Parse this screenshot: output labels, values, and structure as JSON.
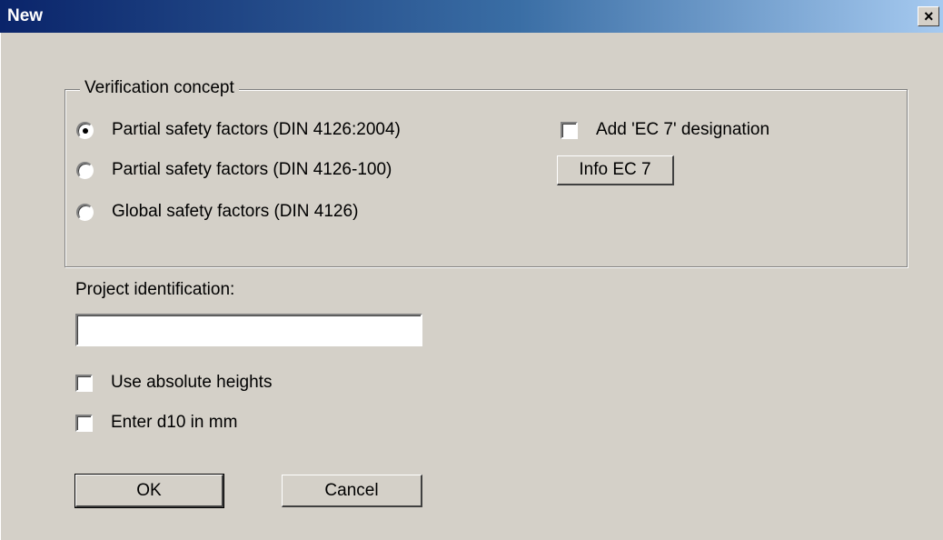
{
  "window": {
    "title": "New",
    "close_glyph": "×",
    "close_icon": "close-icon"
  },
  "verification": {
    "group_label": "Verification concept",
    "options": [
      {
        "label": "Partial safety factors (DIN 4126:2004)",
        "selected": true
      },
      {
        "label": "Partial safety factors (DIN 4126-100)",
        "selected": false
      },
      {
        "label": "Global safety factors (DIN 4126)",
        "selected": false
      }
    ],
    "ec7_checkbox_label": "Add 'EC 7' designation",
    "ec7_checked": false,
    "info_button_label": "Info EC 7"
  },
  "project": {
    "label": "Project identification:",
    "value": "",
    "use_absolute_heights_label": "Use absolute heights",
    "use_absolute_heights_checked": false,
    "enter_d10_label": "Enter d10 in mm",
    "enter_d10_checked": false
  },
  "buttons": {
    "ok_label": "OK",
    "cancel_label": "Cancel"
  },
  "colors": {
    "dialog_bg": "#d4d0c8",
    "title_start": "#0a246a",
    "title_end": "#a6caf0"
  }
}
